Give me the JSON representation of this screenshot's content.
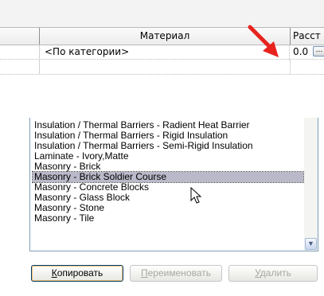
{
  "grid": {
    "header": {
      "material_label": "Материал",
      "distance_label": "Расст"
    },
    "row": {
      "material_value": "<По категории>",
      "distance_value": "0.0",
      "browse_label": "..."
    }
  },
  "material_list": {
    "items": [
      "Insulation / Thermal Barriers - Radient Heat Barrier",
      "Insulation / Thermal Barriers - Rigid Insulation",
      "Insulation / Thermal Barriers - Semi-Rigid Insulation",
      "Laminate - Ivory,Matte",
      "Masonry - Brick",
      "Masonry - Brick Soldier Course",
      "Masonry - Concrete Blocks",
      "Masonry - Glass Block",
      "Masonry - Stone",
      "Masonry - Tile"
    ],
    "selected_index": 5
  },
  "buttons": {
    "copy_accel": "К",
    "copy_rest": "опировать",
    "rename_accel": "П",
    "rename_rest": "ереименовать",
    "delete_accel": "У",
    "delete_rest": "далить"
  },
  "icons": {
    "arrow": "red-arrow-icon",
    "cursor": "mouse-pointer-icon",
    "scroll_down": "chevron-down-icon"
  },
  "colors": {
    "arrow": "#e8231e",
    "selection": "#b9b9c9",
    "list_border": "#7f9db9"
  }
}
